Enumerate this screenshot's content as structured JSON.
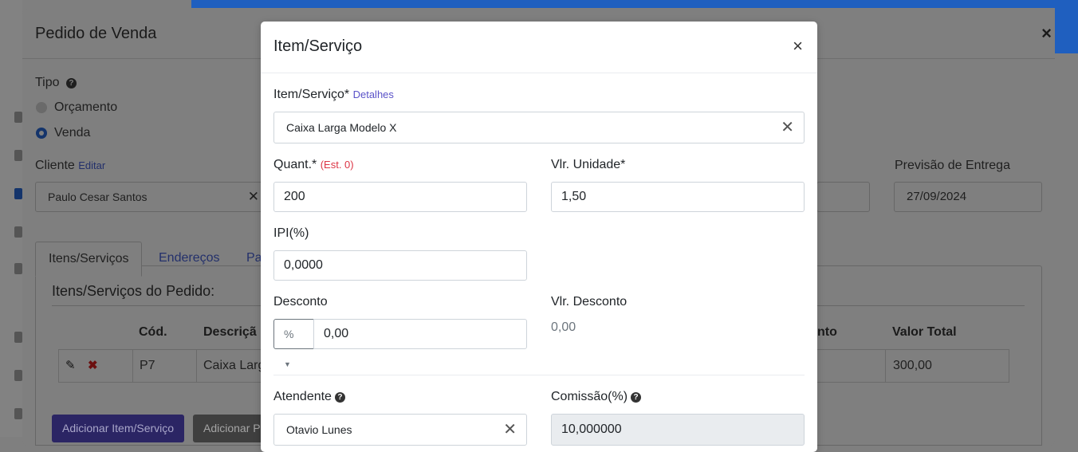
{
  "background": {
    "outer_modal": {
      "title": "Pedido de Venda",
      "close": "×",
      "tipo_label": "Tipo",
      "options": [
        "Orçamento",
        "Venda"
      ],
      "selected_option": "Venda",
      "cliente_label": "Cliente",
      "cliente_edit": "Editar",
      "cliente_value": "Paulo Cesar Santos",
      "previsao_label": "Previsão de Entrega",
      "previsao_value": "27/09/2024",
      "tabs": [
        "Itens/Serviços",
        "Endereços",
        "Pa"
      ],
      "section_title": "Itens/Serviços do Pedido:",
      "table": {
        "headers": [
          "Cód.",
          "Descriçã",
          "nto",
          "Valor Total"
        ],
        "row": {
          "code": "P7",
          "desc": "Caixa Larg",
          "total": "300,00"
        }
      },
      "btn_add": "Adicionar Item/Serviço",
      "btn_add2": "Adicionar P"
    },
    "accent": "#1f5fbf"
  },
  "modal": {
    "title": "Item/Serviço",
    "close": "×",
    "item_label": "Item/Serviço*",
    "item_details": "Detalhes",
    "item_value": "Caixa Larga Modelo X",
    "qty_label": "Quant.*",
    "qty_stock": "(Est. 0)",
    "qty_value": "200",
    "unit_label": "Vlr. Unidade*",
    "unit_value": "1,50",
    "ipi_label": "IPI(%)",
    "ipi_value": "0,0000",
    "desc_label": "Desconto",
    "desc_type": "%",
    "desc_value": "0,00",
    "vdesc_label": "Vlr. Desconto",
    "vdesc_value": "0,00",
    "attendant_label": "Atendente",
    "attendant_value": "Otavio Lunes",
    "commission_label": "Comissão(%)",
    "commission_value": "10,000000",
    "help_glyph": "?",
    "clear_glyph": "✕"
  }
}
